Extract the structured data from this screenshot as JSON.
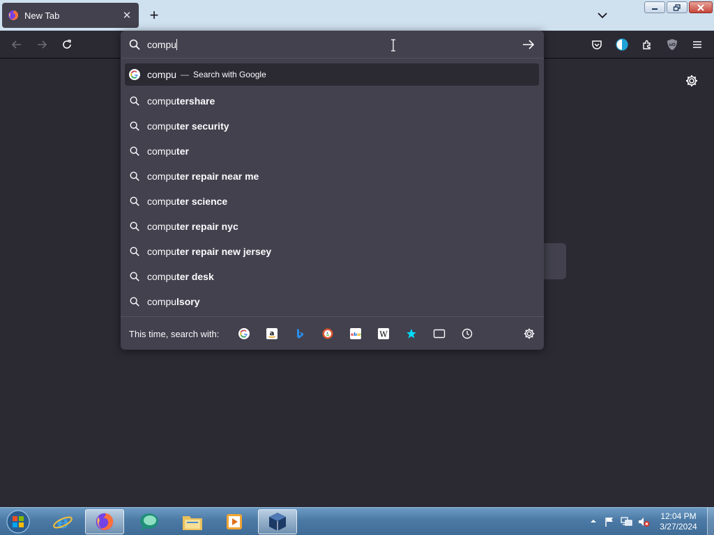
{
  "window": {
    "tab_title": "New Tab",
    "tab_close_glyph": "✕",
    "new_tab_glyph": "+"
  },
  "urlbar": {
    "value": "compu",
    "first_suggestion": {
      "typed": "compu",
      "separator": "—",
      "hint": "Search with Google"
    },
    "suggestions": [
      {
        "prefix": "compu",
        "completion": "tershare"
      },
      {
        "prefix": "compu",
        "completion": "ter security"
      },
      {
        "prefix": "compu",
        "completion": "ter"
      },
      {
        "prefix": "compu",
        "completion": "ter repair near me"
      },
      {
        "prefix": "compu",
        "completion": "ter science"
      },
      {
        "prefix": "compu",
        "completion": "ter repair nyc"
      },
      {
        "prefix": "compu",
        "completion": "ter repair new jersey"
      },
      {
        "prefix": "compu",
        "completion": "ter desk"
      },
      {
        "prefix": "compu",
        "completion": "lsory"
      }
    ],
    "one_off_label": "This time, search with:",
    "one_off_engines": [
      "google-icon",
      "amazon-icon",
      "bing-icon",
      "duckduckgo-icon",
      "ebay-icon",
      "wikipedia-icon",
      "bookmarks-star-icon",
      "tabs-icon",
      "history-icon"
    ]
  },
  "toolbar_icons": [
    "back-arrow-icon",
    "forward-arrow-icon",
    "reload-icon",
    "pocket-icon",
    "dark-reader-icon",
    "extensions-icon",
    "ublock-origin-icon",
    "menu-icon"
  ],
  "taskbar": {
    "time": "12:04 PM",
    "date": "3/27/2024"
  },
  "colors": {
    "page_bg": "#2b2a33",
    "popup_bg": "#42414d",
    "tabstrip_bg": "#cfe0ef",
    "text": "#fbfbfe"
  }
}
